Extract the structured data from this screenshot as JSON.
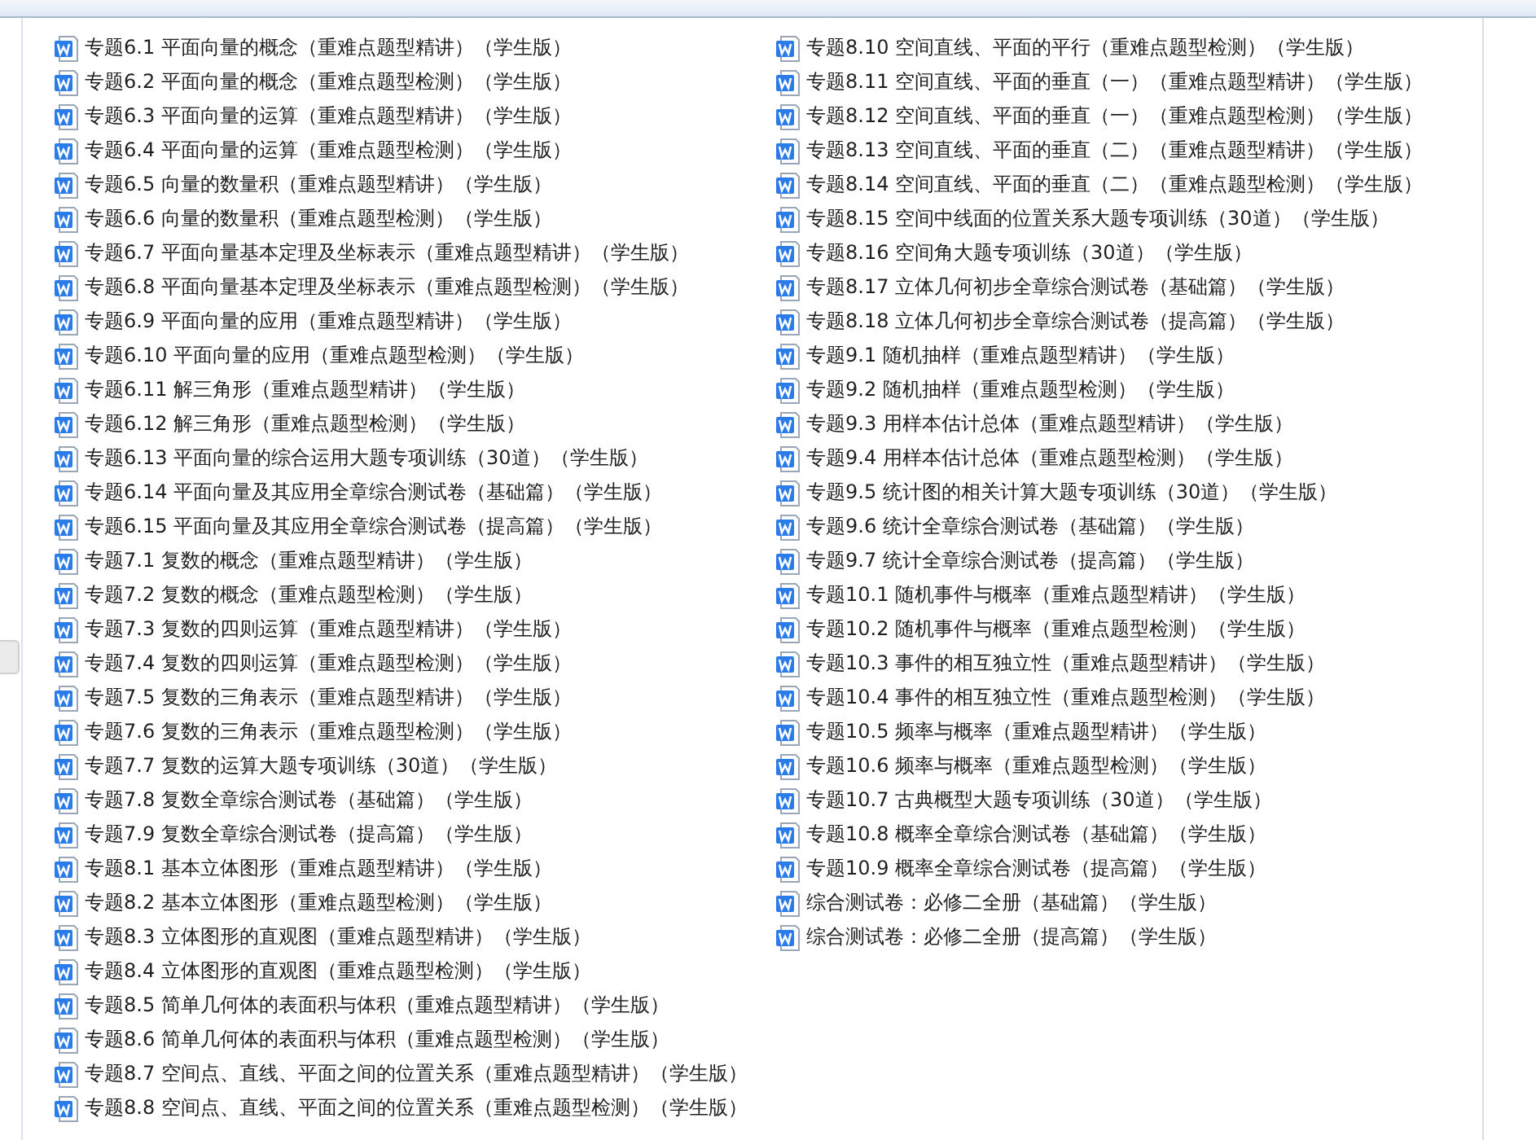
{
  "file_list": {
    "columns": [
      {
        "items": [
          {
            "name": "专题6.1 平面向量的概念（重难点题型精讲）（学生版）"
          },
          {
            "name": "专题6.2 平面向量的概念（重难点题型检测）（学生版）"
          },
          {
            "name": "专题6.3 平面向量的运算（重难点题型精讲）（学生版）"
          },
          {
            "name": "专题6.4 平面向量的运算（重难点题型检测）（学生版）"
          },
          {
            "name": "专题6.5 向量的数量积（重难点题型精讲）（学生版）"
          },
          {
            "name": "专题6.6 向量的数量积（重难点题型检测）（学生版）"
          },
          {
            "name": "专题6.7 平面向量基本定理及坐标表示（重难点题型精讲）（学生版）"
          },
          {
            "name": "专题6.8 平面向量基本定理及坐标表示（重难点题型检测）（学生版）"
          },
          {
            "name": "专题6.9 平面向量的应用（重难点题型精讲）（学生版）"
          },
          {
            "name": "专题6.10 平面向量的应用（重难点题型检测）（学生版）"
          },
          {
            "name": "专题6.11 解三角形（重难点题型精讲）（学生版）"
          },
          {
            "name": "专题6.12 解三角形（重难点题型检测）（学生版）"
          },
          {
            "name": "专题6.13 平面向量的综合运用大题专项训练（30道）（学生版）"
          },
          {
            "name": "专题6.14 平面向量及其应用全章综合测试卷（基础篇）（学生版）"
          },
          {
            "name": "专题6.15 平面向量及其应用全章综合测试卷（提高篇）（学生版）"
          },
          {
            "name": "专题7.1 复数的概念（重难点题型精讲）（学生版）"
          },
          {
            "name": "专题7.2 复数的概念（重难点题型检测）（学生版）"
          },
          {
            "name": "专题7.3 复数的四则运算（重难点题型精讲）（学生版）"
          },
          {
            "name": "专题7.4 复数的四则运算（重难点题型检测）（学生版）"
          },
          {
            "name": "专题7.5 复数的三角表示（重难点题型精讲）（学生版）"
          },
          {
            "name": "专题7.6 复数的三角表示（重难点题型检测）（学生版）"
          },
          {
            "name": "专题7.7 复数的运算大题专项训练（30道）（学生版）"
          },
          {
            "name": "专题7.8 复数全章综合测试卷（基础篇）（学生版）"
          },
          {
            "name": "专题7.9 复数全章综合测试卷（提高篇）（学生版）"
          },
          {
            "name": "专题8.1 基本立体图形（重难点题型精讲）（学生版）"
          },
          {
            "name": "专题8.2 基本立体图形（重难点题型检测）（学生版）"
          },
          {
            "name": "专题8.3 立体图形的直观图（重难点题型精讲）（学生版）"
          },
          {
            "name": "专题8.4 立体图形的直观图（重难点题型检测）（学生版）"
          },
          {
            "name": "专题8.5 简单几何体的表面积与体积（重难点题型精讲）（学生版）"
          },
          {
            "name": "专题8.6 简单几何体的表面积与体积（重难点题型检测）（学生版）"
          },
          {
            "name": "专题8.7 空间点、直线、平面之间的位置关系（重难点题型精讲）（学生版）"
          },
          {
            "name": "专题8.8 空间点、直线、平面之间的位置关系（重难点题型检测）（学生版）"
          }
        ]
      },
      {
        "items": [
          {
            "name": "专题8.10 空间直线、平面的平行（重难点题型检测）（学生版）"
          },
          {
            "name": "专题8.11 空间直线、平面的垂直（一）（重难点题型精讲）（学生版）"
          },
          {
            "name": "专题8.12 空间直线、平面的垂直（一）（重难点题型检测）（学生版）"
          },
          {
            "name": "专题8.13 空间直线、平面的垂直（二）（重难点题型精讲）（学生版）"
          },
          {
            "name": "专题8.14 空间直线、平面的垂直（二）（重难点题型检测）（学生版）"
          },
          {
            "name": "专题8.15 空间中线面的位置关系大题专项训练（30道）（学生版）"
          },
          {
            "name": "专题8.16 空间角大题专项训练（30道）（学生版）"
          },
          {
            "name": "专题8.17 立体几何初步全章综合测试卷（基础篇）（学生版）"
          },
          {
            "name": "专题8.18 立体几何初步全章综合测试卷（提高篇）（学生版）"
          },
          {
            "name": "专题9.1 随机抽样（重难点题型精讲）（学生版）"
          },
          {
            "name": "专题9.2 随机抽样（重难点题型检测）（学生版）"
          },
          {
            "name": "专题9.3 用样本估计总体（重难点题型精讲）（学生版）"
          },
          {
            "name": "专题9.4 用样本估计总体（重难点题型检测）（学生版）"
          },
          {
            "name": "专题9.5 统计图的相关计算大题专项训练（30道）（学生版）"
          },
          {
            "name": "专题9.6 统计全章综合测试卷（基础篇）（学生版）"
          },
          {
            "name": "专题9.7 统计全章综合测试卷（提高篇）（学生版）"
          },
          {
            "name": "专题10.1 随机事件与概率（重难点题型精讲）（学生版）"
          },
          {
            "name": "专题10.2 随机事件与概率（重难点题型检测）（学生版）"
          },
          {
            "name": "专题10.3 事件的相互独立性（重难点题型精讲）（学生版）"
          },
          {
            "name": "专题10.4 事件的相互独立性（重难点题型检测）（学生版）"
          },
          {
            "name": "专题10.5 频率与概率（重难点题型精讲）（学生版）"
          },
          {
            "name": "专题10.6 频率与概率（重难点题型检测）（学生版）"
          },
          {
            "name": "专题10.7 古典概型大题专项训练（30道）（学生版）"
          },
          {
            "name": "专题10.8 概率全章综合测试卷（基础篇）（学生版）"
          },
          {
            "name": "专题10.9 概率全章综合测试卷（提高篇）（学生版）"
          },
          {
            "name": "综合测试卷：必修二全册（基础篇）（学生版）"
          },
          {
            "name": "综合测试卷：必修二全册（提高篇）（学生版）"
          }
        ]
      }
    ]
  }
}
